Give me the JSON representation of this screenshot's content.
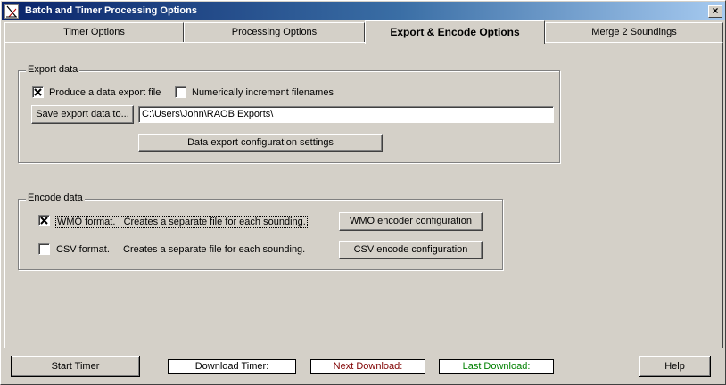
{
  "window": {
    "title": "Batch and Timer Processing Options",
    "close_glyph": "×"
  },
  "tabs": [
    {
      "label": "Timer Options",
      "active": false
    },
    {
      "label": "Processing Options",
      "active": false
    },
    {
      "label": "Export & Encode Options",
      "active": true
    },
    {
      "label": "Merge 2 Soundings",
      "active": false
    }
  ],
  "export_group": {
    "legend": "Export data",
    "produce_export_label": "Produce a data export file",
    "produce_export_checked": true,
    "increment_label": "Numerically increment filenames",
    "increment_checked": false,
    "save_button_label": "Save export data to...",
    "path_value": "C:\\Users\\John\\RAOB Exports\\",
    "config_button_label": "Data export configuration settings"
  },
  "encode_group": {
    "legend": "Encode data",
    "wmo_label": "WMO format.",
    "wmo_checked": true,
    "wmo_desc": "Creates a separate file for each sounding.",
    "wmo_button_label": "WMO encoder configuration",
    "csv_label": "CSV format.",
    "csv_checked": false,
    "csv_desc": "Creates a separate file for each sounding.",
    "csv_button_label": "CSV encode configuration"
  },
  "footer": {
    "start_timer_label": "Start Timer",
    "download_timer_label": "Download Timer:",
    "next_download_label": "Next Download:",
    "last_download_label": "Last Download:",
    "help_label": "Help"
  },
  "colors": {
    "next_download_text": "#800000",
    "last_download_text": "#008000"
  }
}
